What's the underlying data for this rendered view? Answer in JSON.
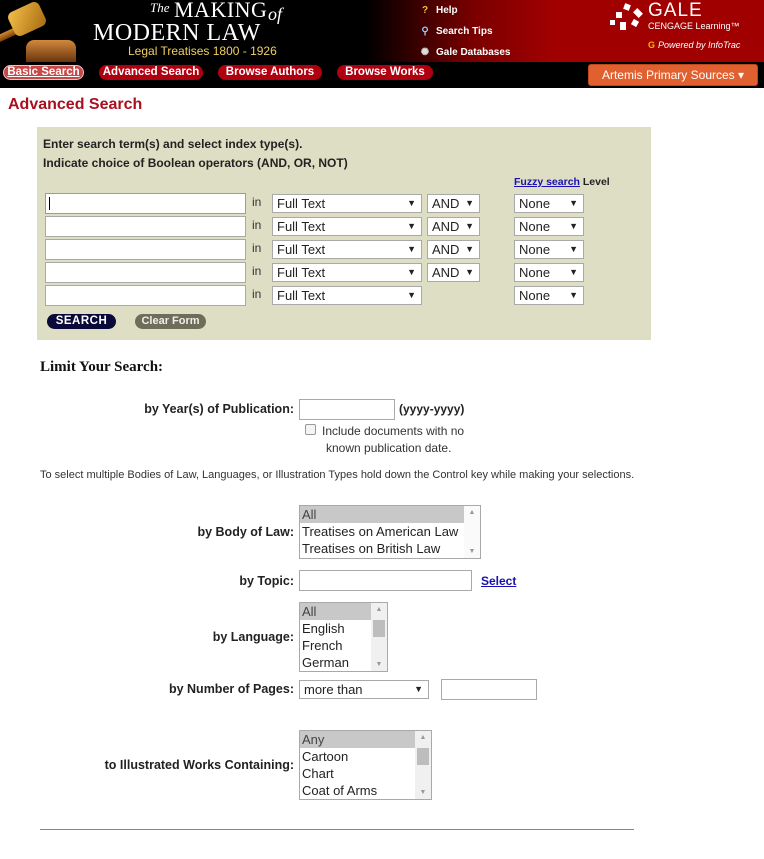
{
  "header": {
    "logo": {
      "the": "The",
      "making": "MAKING",
      "of": "of",
      "modern_law": "MODERN LAW",
      "subtitle": "Legal Treatises 1800 - 1926"
    },
    "links": [
      {
        "label": "Help",
        "icon": "help-icon"
      },
      {
        "label": "Search Tips",
        "icon": "magnifier-icon"
      },
      {
        "label": "Gale Databases",
        "icon": "databases-icon"
      }
    ],
    "brand": {
      "name": "GALE",
      "tagline": "CENGAGE Learning™",
      "powered_by": "Powered by InfoTrac"
    }
  },
  "nav": {
    "tabs": [
      {
        "label": "Basic Search",
        "active": true
      },
      {
        "label": "Advanced Search",
        "active": false
      },
      {
        "label": "Browse Authors",
        "active": false
      },
      {
        "label": "Browse Works",
        "active": false
      }
    ],
    "artemis_label": "Artemis Primary Sources ▾"
  },
  "page": {
    "title": "Advanced Search"
  },
  "search": {
    "instructions_line1": "Enter search term(s) and select index type(s).",
    "instructions_line2": "Indicate choice of Boolean operators (AND, OR, NOT)",
    "fuzzy_link": "Fuzzy search",
    "fuzzy_level_label": "Level",
    "in_label": "in",
    "rows": [
      {
        "term": "",
        "index": "Full Text",
        "operator": "AND",
        "fuzzy": "None"
      },
      {
        "term": "",
        "index": "Full Text",
        "operator": "AND",
        "fuzzy": "None"
      },
      {
        "term": "",
        "index": "Full Text",
        "operator": "AND",
        "fuzzy": "None"
      },
      {
        "term": "",
        "index": "Full Text",
        "operator": "AND",
        "fuzzy": "None"
      },
      {
        "term": "",
        "index": "Full Text",
        "operator": null,
        "fuzzy": "None"
      }
    ],
    "search_button": "SEARCH",
    "clear_button": "Clear Form"
  },
  "limits": {
    "title": "Limit Your Search:",
    "year_label": "by Year(s) of Publication:",
    "year_value": "",
    "year_format": "(yyyy-yyyy)",
    "include_undated_line1": "Include documents with no",
    "include_undated_line2": "known publication date.",
    "include_undated_checked": false,
    "hint": "To select multiple Bodies of Law, Languages, or Illustration Types hold down the Control key while making your selections.",
    "body_of_law_label": "by Body of Law:",
    "body_of_law_options": [
      "All",
      "Treatises on American Law",
      "Treatises on British Law"
    ],
    "body_of_law_selected": "All",
    "topic_label": "by Topic:",
    "topic_value": "",
    "topic_select_link": "Select",
    "language_label": "by Language:",
    "language_options": [
      "All",
      "English",
      "French",
      "German"
    ],
    "language_selected": "All",
    "pages_label": "by Number of Pages:",
    "pages_comparator": "more than",
    "pages_value": "",
    "illustrated_label": "to Illustrated Works Containing:",
    "illustrated_options": [
      "Any",
      "Cartoon",
      "Chart",
      "Coat of Arms"
    ],
    "illustrated_selected": "Any"
  },
  "colors": {
    "brand_red": "#a00000",
    "title_red": "#a81020",
    "search_panel": "#dedec4",
    "artemis_orange": "#e06030",
    "link_blue": "#1a0fb0"
  }
}
